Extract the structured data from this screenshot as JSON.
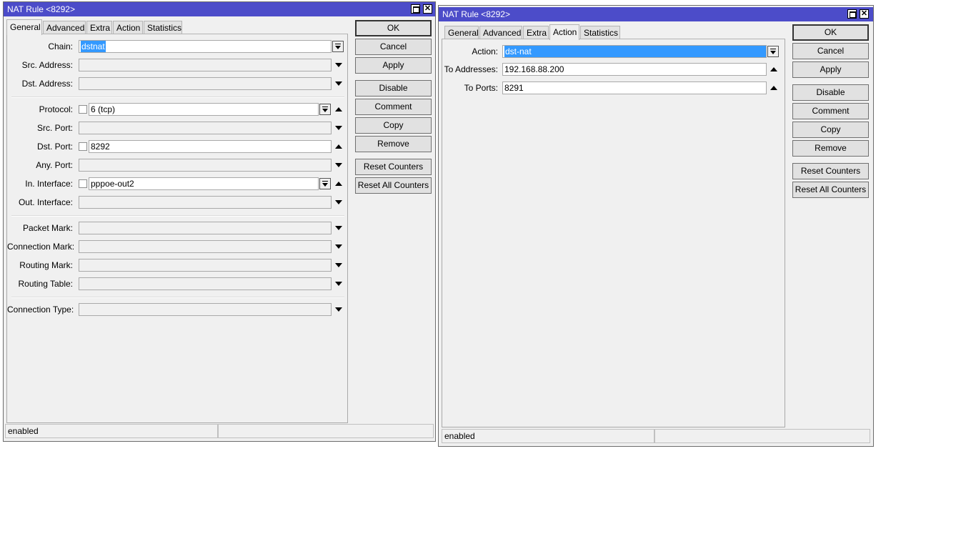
{
  "windows": [
    {
      "title": "NAT Rule <8292>",
      "tabs": [
        "General",
        "Advanced",
        "Extra",
        "Action",
        "Statistics"
      ],
      "active_tab": "General",
      "fields": {
        "chain": {
          "label": "Chain:",
          "value": "dstnat"
        },
        "src_address": {
          "label": "Src. Address:",
          "value": ""
        },
        "dst_address": {
          "label": "Dst. Address:",
          "value": ""
        },
        "protocol": {
          "label": "Protocol:",
          "value": "6 (tcp)"
        },
        "src_port": {
          "label": "Src. Port:",
          "value": ""
        },
        "dst_port": {
          "label": "Dst. Port:",
          "value": "8292"
        },
        "any_port": {
          "label": "Any. Port:",
          "value": ""
        },
        "in_interface": {
          "label": "In. Interface:",
          "value": "pppoe-out2"
        },
        "out_interface": {
          "label": "Out. Interface:",
          "value": ""
        },
        "packet_mark": {
          "label": "Packet Mark:",
          "value": ""
        },
        "connection_mark": {
          "label": "Connection Mark:",
          "value": ""
        },
        "routing_mark": {
          "label": "Routing Mark:",
          "value": ""
        },
        "routing_table": {
          "label": "Routing Table:",
          "value": ""
        },
        "connection_type": {
          "label": "Connection Type:",
          "value": ""
        }
      },
      "buttons": {
        "ok": "OK",
        "cancel": "Cancel",
        "apply": "Apply",
        "disable": "Disable",
        "comment": "Comment",
        "copy": "Copy",
        "remove": "Remove",
        "reset_counters": "Reset Counters",
        "reset_all_counters": "Reset All Counters"
      },
      "status": "enabled"
    },
    {
      "title": "NAT Rule <8292>",
      "tabs": [
        "General",
        "Advanced",
        "Extra",
        "Action",
        "Statistics"
      ],
      "active_tab": "Action",
      "fields": {
        "action": {
          "label": "Action:",
          "value": "dst-nat"
        },
        "to_addresses": {
          "label": "To Addresses:",
          "value": "192.168.88.200"
        },
        "to_ports": {
          "label": "To Ports:",
          "value": "8291"
        }
      },
      "buttons": {
        "ok": "OK",
        "cancel": "Cancel",
        "apply": "Apply",
        "disable": "Disable",
        "comment": "Comment",
        "copy": "Copy",
        "remove": "Remove",
        "reset_counters": "Reset Counters",
        "reset_all_counters": "Reset All Counters"
      },
      "status": "enabled"
    }
  ],
  "icons": {
    "restore": "restore-icon",
    "close": "close-icon"
  },
  "colors": {
    "titlebar": "#4c4cc9",
    "selection": "#3399ff",
    "window_bg": "#f0f0f0"
  }
}
